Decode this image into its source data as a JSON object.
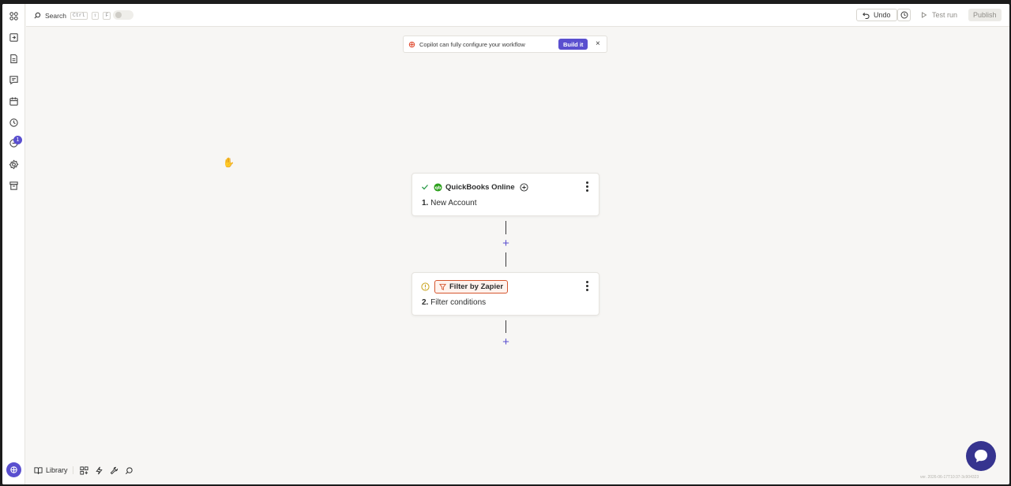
{
  "topbar": {
    "search_label": "Search",
    "shortcut_keys": [
      "Ctrl",
      "⇧",
      "F"
    ],
    "undo_label": "Undo",
    "test_run_label": "Test run",
    "publish_label": "Publish"
  },
  "rail": {
    "notification_count": "1",
    "icons": [
      "apps-icon",
      "zap-import-icon",
      "document-icon",
      "chat-icon",
      "calendar-icon",
      "history-icon",
      "notification-icon",
      "settings-icon",
      "archive-icon"
    ]
  },
  "banner": {
    "text": "Copilot can fully configure your workflow",
    "button_label": "Build it",
    "close_glyph": "×"
  },
  "steps": [
    {
      "number": "1.",
      "title": "New Account",
      "app": "QuickBooks Online",
      "status": "complete"
    },
    {
      "number": "2.",
      "title": "Filter conditions",
      "app": "Filter by Zapier",
      "status": "warning"
    }
  ],
  "add_step_glyph": "+",
  "bottombar": {
    "library_label": "Library"
  },
  "version": "ver. 2026-06-17T10:37-3c904323",
  "colors": {
    "accent": "#5a4fcf",
    "chat_fab": "#36348f",
    "success": "#2c9b4a",
    "warning": "#c8a21a",
    "filter_chip": "#d4552e"
  }
}
